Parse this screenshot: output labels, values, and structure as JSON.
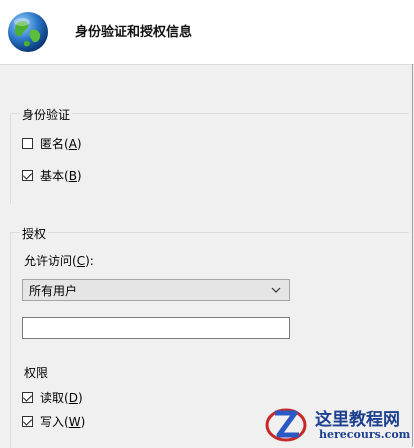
{
  "header": {
    "title": "身份验证和授权信息"
  },
  "auth": {
    "title": "身份验证",
    "anonymous": {
      "label": "匿名(",
      "key": "A",
      "suffix": ")",
      "checked": false
    },
    "basic": {
      "label": "基本(",
      "key": "B",
      "suffix": ")",
      "checked": true
    }
  },
  "authorization": {
    "title": "授权",
    "allow_label": "允许访问(",
    "allow_key": "C",
    "allow_suffix": "):",
    "dropdown_value": "所有用户",
    "textbox_value": "",
    "permissions_title": "权限",
    "read": {
      "label": "读取(",
      "key": "D",
      "suffix": ")",
      "checked": true
    },
    "write": {
      "label": "写入(",
      "key": "W",
      "suffix": ")",
      "checked": true
    }
  },
  "watermark": {
    "brand": "这里教程网",
    "url": "herecours.com"
  },
  "colors": {
    "background": "#f0f0f0",
    "header_bg": "#ffffff",
    "dropdown_bg": "#e5e5e5"
  },
  "icons": {
    "app": "globe-icon",
    "dropdown": "chevron-down-icon"
  }
}
